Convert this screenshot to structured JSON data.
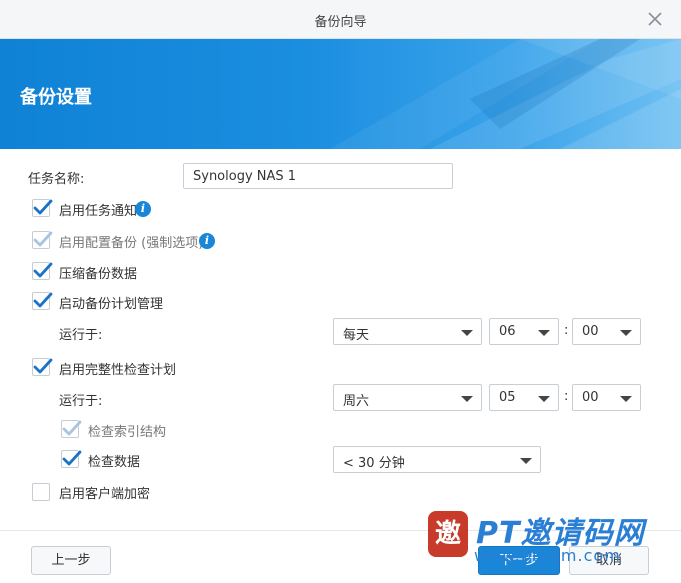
{
  "window": {
    "title": "备份向导",
    "close_icon": "close-icon"
  },
  "banner": {
    "heading": "备份设置",
    "colors": {
      "start": "#0f82d6",
      "end": "#6fc0f2"
    }
  },
  "form": {
    "task_name_label": "任务名称:",
    "task_name_value": "Synology NAS 1",
    "enable_notification": {
      "label": "启用任务通知",
      "checked": true
    },
    "enable_config_backup": {
      "label": "启用配置备份 (强制选项)",
      "checked": true,
      "disabled": true
    },
    "compress_backup": {
      "label": "压缩备份数据",
      "checked": true
    },
    "backup_schedule": {
      "label": "启动备份计划管理",
      "checked": true,
      "run_label": "运行于:",
      "frequency": "每天",
      "hour": "06",
      "minute": "00"
    },
    "integrity_check": {
      "label": "启用完整性检查计划",
      "checked": true,
      "run_label": "运行于:",
      "day": "周六",
      "hour": "05",
      "minute": "00",
      "check_index": {
        "label": "检查索引结构",
        "checked": true,
        "disabled": true
      },
      "check_data": {
        "label": "检查数据",
        "checked": true
      },
      "duration": "< 30 分钟"
    },
    "client_encryption": {
      "label": "启用客户端加密",
      "checked": false
    },
    "time_separator": ":"
  },
  "footer": {
    "prev_label": "上一步",
    "next_label": "下一步",
    "cancel_label": "取消"
  },
  "watermark": {
    "logo_char": "邀",
    "text": "PT邀请码网",
    "url": "www.ptyqm.com"
  },
  "accent_color": "#1a86d8"
}
